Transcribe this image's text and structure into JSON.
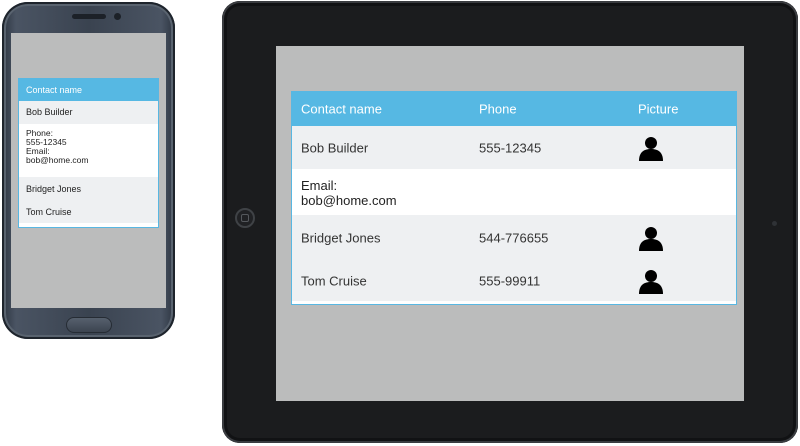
{
  "phone": {
    "table": {
      "header": "Contact name",
      "rows": [
        {
          "name": "Bob Builder"
        },
        {
          "name": "Bridget Jones"
        },
        {
          "name": "Tom Cruise"
        }
      ],
      "detail": {
        "phone_label": "Phone:",
        "phone_value": "555-12345",
        "email_label": "Email:",
        "email_value": "bob@home.com"
      }
    }
  },
  "tablet": {
    "table": {
      "headers": {
        "name": "Contact name",
        "phone": "Phone",
        "picture": "Picture"
      },
      "rows": [
        {
          "name": "Bob Builder",
          "phone": "555-12345",
          "picture": "person-icon"
        },
        {
          "name": "Bridget Jones",
          "phone": "544-776655",
          "picture": "person-icon"
        },
        {
          "name": "Tom Cruise",
          "phone": "555-99911",
          "picture": "person-icon"
        }
      ],
      "detail": {
        "email_label": "Email:",
        "email_value": "bob@home.com"
      }
    }
  },
  "colors": {
    "header_bg": "#56b8e3",
    "row_bg": "#eef0f2",
    "screen_bg": "#bbbcbc",
    "device_frame": "#1b1c1e"
  }
}
